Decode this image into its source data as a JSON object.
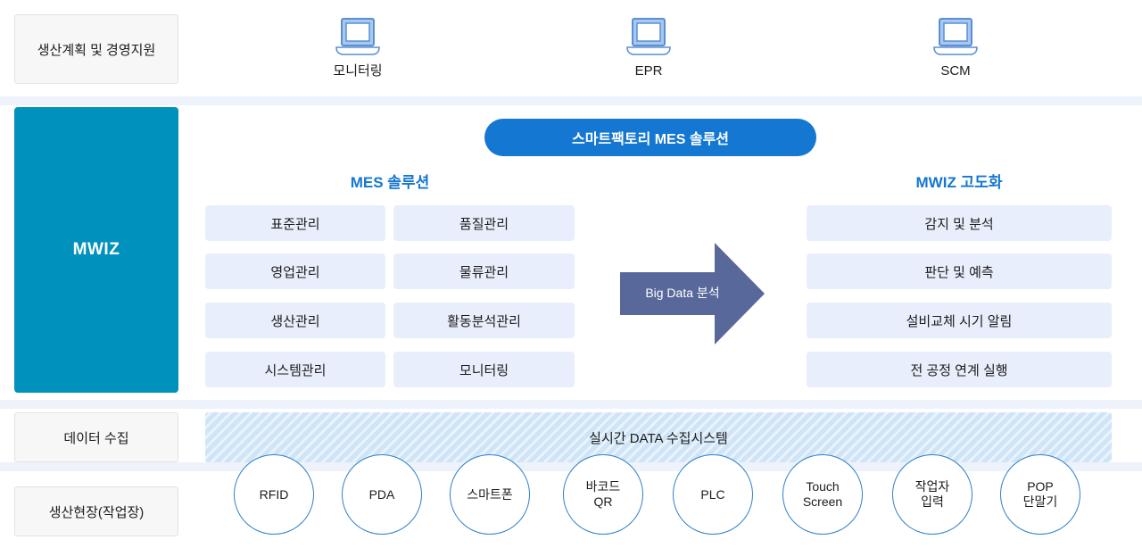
{
  "stages": [
    {
      "name": "planning",
      "label": "생산계획 및 경영지원"
    },
    {
      "name": "collect",
      "label": "데이터 수집"
    },
    {
      "name": "floor",
      "label": "생산현장(작업장)"
    }
  ],
  "top_systems": [
    {
      "icon": "laptop-icon",
      "label": "모니터링"
    },
    {
      "icon": "laptop-icon",
      "label": "EPR"
    },
    {
      "icon": "laptop-icon",
      "label": "SCM"
    }
  ],
  "mwiz_block": {
    "label": "MWIZ"
  },
  "banner": {
    "label": "스마트팩토리 MES 솔루션"
  },
  "mes_column": {
    "heading": "MES 솔루션",
    "left_items": [
      "표준관리",
      "영업관리",
      "생산관리",
      "시스템관리"
    ],
    "right_items": [
      "품질관리",
      "물류관리",
      "활동분석관리",
      "모니터링"
    ]
  },
  "arrow": {
    "label": "Big Data  분석"
  },
  "advanced_column": {
    "heading": "MWIZ 고도화",
    "items": [
      "감지 및 분석",
      "판단 및 예측",
      "설비교체 시기 알림",
      "전 공정 연계 실행"
    ]
  },
  "data_bar": {
    "label": "실시간 DATA 수집시스템"
  },
  "devices": [
    {
      "label": "RFID"
    },
    {
      "label": "PDA"
    },
    {
      "label": "스마트폰"
    },
    {
      "label": "바코드\nQR"
    },
    {
      "label": "PLC"
    },
    {
      "label": "Touch\nScreen"
    },
    {
      "label": "작업자\n입력"
    },
    {
      "label": "POP\n단말기"
    }
  ],
  "colors": {
    "mwiz_teal": "#0092bc",
    "banner_blue": "#1477d1",
    "heading_blue": "#1477d1",
    "module_bg": "#e8eefb",
    "arrow_slate": "#58689a",
    "stripe_blue": "#cfe4f7",
    "circle_border": "#2f80c8",
    "divider": "#eef2fa"
  }
}
